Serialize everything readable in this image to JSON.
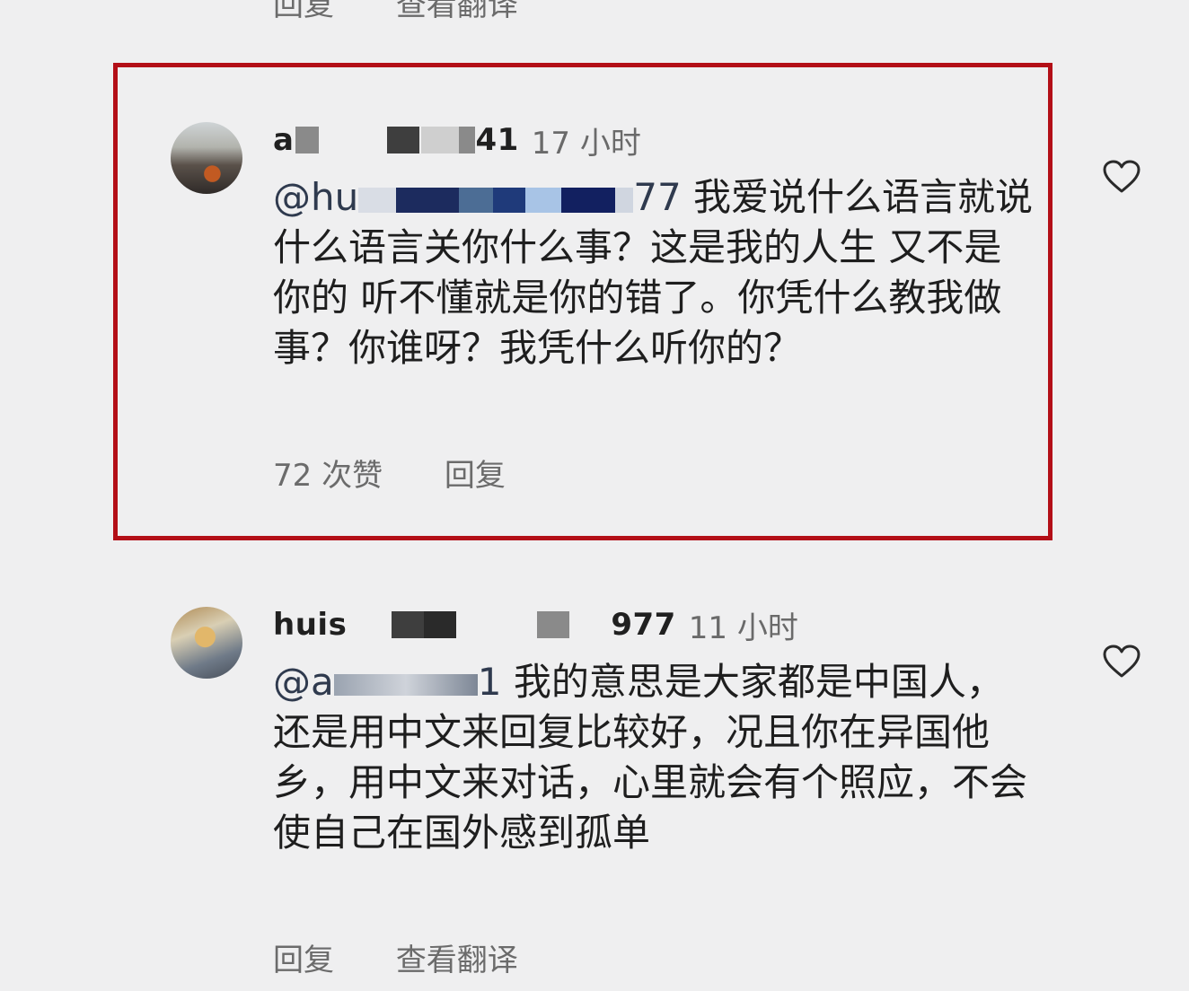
{
  "top_actions": {
    "reply": "回复",
    "translate": "查看翻译"
  },
  "comments": [
    {
      "username_visible": "a",
      "username_suffix": "41",
      "time": "17 小时",
      "mention": "@hu",
      "mention_suffix": "77",
      "text_after_mention": " 我爱说什么语言就说什么语言关你什么事？这是我的人生 又不是你的 听不懂就是你的错了。你凭什么教我做事？你谁呀？我凭什么听你的？",
      "likes": "72 次赞",
      "reply": "回复",
      "like_icon": "heart-icon",
      "highlighted": true
    },
    {
      "username_visible": "huis",
      "username_suffix": "977",
      "time": "11 小时",
      "mention": "@a",
      "mention_suffix": "1",
      "text_after_mention": " 我的意思是大家都是中国人，还是用中文来回复比较好，况且你在异国他乡，用中文来对话，心里就会有个照应，不会使自己在国外感到孤单",
      "reply": "回复",
      "translate": "查看翻译",
      "like_icon": "heart-icon",
      "highlighted": false
    }
  ],
  "colors": {
    "background": "#efeff0",
    "highlight_border": "#b30f17",
    "secondary_text": "#6b6b6b"
  }
}
